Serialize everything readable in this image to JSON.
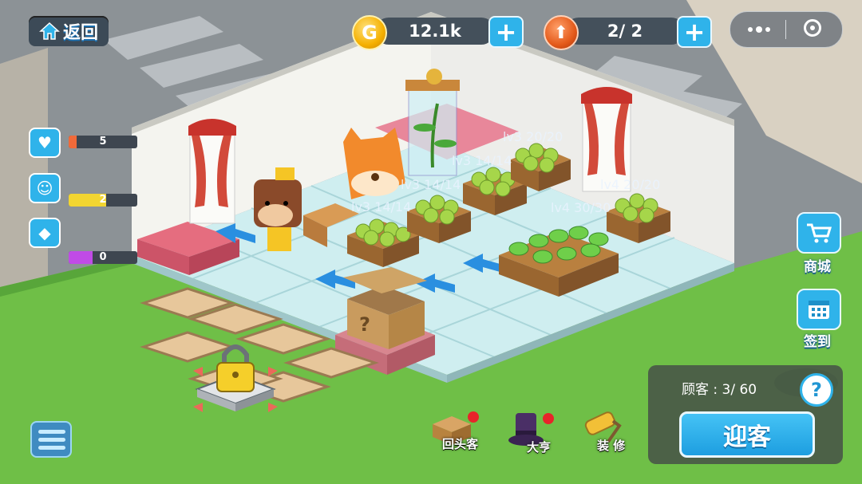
{
  "topbar": {
    "back_label": "返回",
    "gold_amount": "12.1k",
    "coin_letter": "G",
    "upgrade_count": "2/ 2"
  },
  "stats": [
    {
      "icon": "heart-icon",
      "value": "5",
      "fill": 0.12,
      "color": "#f06a3a"
    },
    {
      "icon": "smile-icon",
      "value": "2",
      "fill": 0.55,
      "color": "#f2d531"
    },
    {
      "icon": "diamond-icon",
      "value": "0",
      "fill": 0.35,
      "color": "#c04be6"
    }
  ],
  "shelves": [
    {
      "label": "lv3 14/14"
    },
    {
      "label": "lv3 14/14"
    },
    {
      "label": "lv3 14/14"
    },
    {
      "label": "lv3 20/20"
    },
    {
      "label": "lv4 30/30"
    },
    {
      "label": "lv4 20/20"
    }
  ],
  "side": {
    "shop_label": "商城",
    "checkin_label": "签到"
  },
  "customer": {
    "count_label": "顾客 : 3/ 60",
    "welcome_label": "迎客",
    "help_symbol": "?"
  },
  "bottom": {
    "returning_label": "回头客",
    "tycoon_label": "大亨",
    "decorate_label": "装 修"
  },
  "colors": {
    "accent": "#2fb3ea",
    "grass": "#6fbf47",
    "floor": "#cfeef0"
  }
}
